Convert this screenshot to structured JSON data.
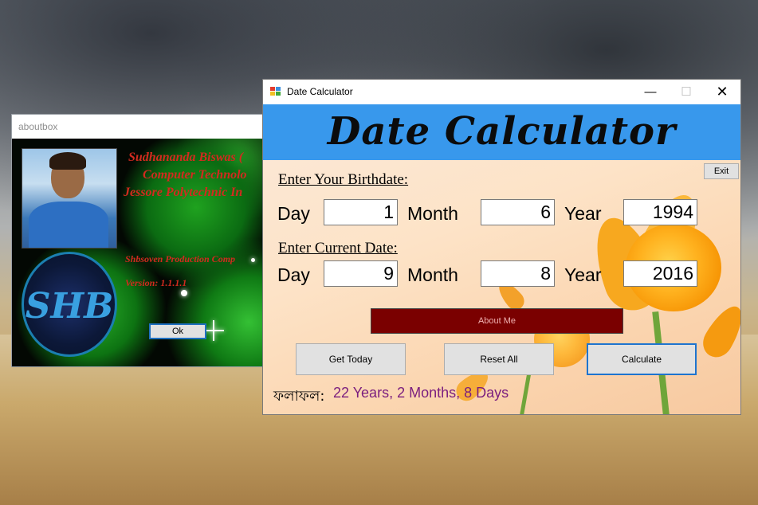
{
  "about_box": {
    "title": "aboutbox",
    "line1": "Sudhananda Biswas (",
    "line2": "Computer Technolo",
    "line3": "Jessore Polytechnic In",
    "line4": "Shbsoven Production Comp",
    "line5": "Version: 1.1.1.1",
    "logo_text": "SHB",
    "ok_label": "Ok"
  },
  "main_window": {
    "title": "Date Calculator",
    "caption": {
      "minimize": "—",
      "maximize": "☐",
      "close": "✕"
    },
    "header_title": "Date Calculator",
    "exit_label": "Exit",
    "birthdate": {
      "section_label": "Enter Your Birthdate:",
      "day_label": "Day",
      "day_value": "1",
      "month_label": "Month",
      "month_value": "6",
      "year_label": "Year",
      "year_value": "1994"
    },
    "current": {
      "section_label": "Enter Current Date:",
      "day_label": "Day",
      "day_value": "9",
      "month_label": "Month",
      "month_value": "8",
      "year_label": "Year",
      "year_value": "2016"
    },
    "about_me_label": "About Me",
    "get_today_label": "Get Today",
    "reset_all_label": "Reset All",
    "calculate_label": "Calculate",
    "result_label": "ফলাফল:",
    "result_value": "22 Years, 2 Months, 8 Days"
  },
  "colors": {
    "header_blue": "#3898ec",
    "about_me_bg": "#7a0000",
    "result_color": "#7a1d7e",
    "focus_border": "#1e74cf"
  }
}
